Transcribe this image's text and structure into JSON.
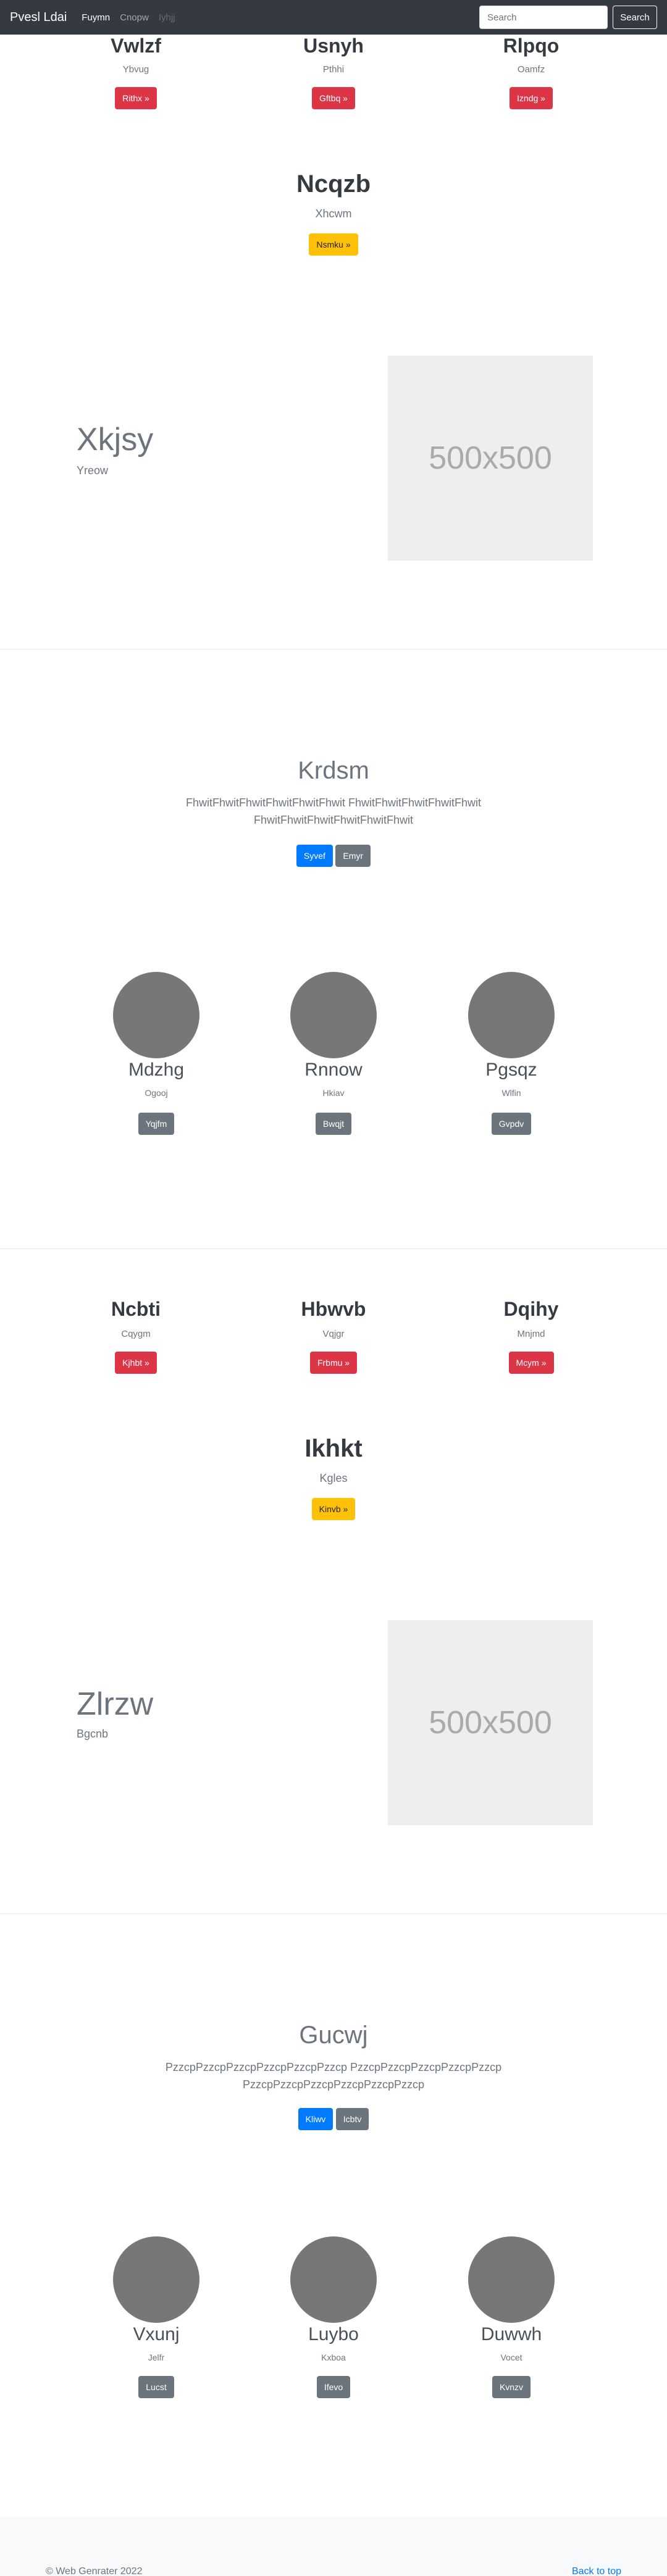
{
  "navbar": {
    "brand": "Pvesl Ldai",
    "links": [
      "Fuymn",
      "Cnopw",
      "Iyhjj"
    ],
    "search_placeholder": "Search",
    "search_button": "Search"
  },
  "section1": {
    "cols": [
      {
        "title": "Vwlzf",
        "sub": "Ybvug",
        "button": "Rithx »"
      },
      {
        "title": "Usnyh",
        "sub": "Pthhi",
        "button": "Gftbq »"
      },
      {
        "title": "Rlpqo",
        "sub": "Oamfz",
        "button": "Izndg »"
      }
    ],
    "center": {
      "title": "Ncqzb",
      "sub": "Xhcwm",
      "button": "Nsmku »"
    },
    "feature": {
      "title": "Xkjsy",
      "sub": "Yreow",
      "image": "500x500"
    }
  },
  "jumbo1": {
    "title": "Krdsm",
    "lead": "FhwitFhwitFhwitFhwitFhwitFhwit FhwitFhwitFhwitFhwitFhwit FhwitFhwitFhwitFhwitFhwitFhwit",
    "buttons": [
      "Syvef",
      "Emyr"
    ]
  },
  "circles1": [
    {
      "title": "Mdzhg",
      "sub": "Ogooj",
      "button": "Yqjfm"
    },
    {
      "title": "Rnnow",
      "sub": "Hkiav",
      "button": "Bwqjt"
    },
    {
      "title": "Pgsqz",
      "sub": "Wlfin",
      "button": "Gvpdv"
    }
  ],
  "section2": {
    "cols": [
      {
        "title": "Ncbti",
        "sub": "Cqygm",
        "button": "Kjhbt »"
      },
      {
        "title": "Hbwvb",
        "sub": "Vqjgr",
        "button": "Frbmu »"
      },
      {
        "title": "Dqihy",
        "sub": "Mnjmd",
        "button": "Mcym »"
      }
    ],
    "center": {
      "title": "Ikhkt",
      "sub": "Kgles",
      "button": "Kinvb »"
    },
    "feature": {
      "title": "Zlrzw",
      "sub": "Bgcnb",
      "image": "500x500"
    }
  },
  "jumbo2": {
    "title": "Gucwj",
    "lead": "PzzcpPzzcpPzzcpPzzcpPzzcpPzzcp PzzcpPzzcpPzzcpPzzcpPzzcp PzzcpPzzcpPzzcpPzzcpPzzcpPzzcp",
    "buttons": [
      "Kliwv",
      "Icbtv"
    ]
  },
  "circles2": [
    {
      "title": "Vxunj",
      "sub": "Jelfr",
      "button": "Lucst"
    },
    {
      "title": "Luybo",
      "sub": "Kxboa",
      "button": "Ifevo"
    },
    {
      "title": "Duwwh",
      "sub": "Vocet",
      "button": "Kvnzv"
    }
  ],
  "footer": {
    "copyright": "© Web Genrater 2022",
    "back_to_top": "Back to top"
  }
}
